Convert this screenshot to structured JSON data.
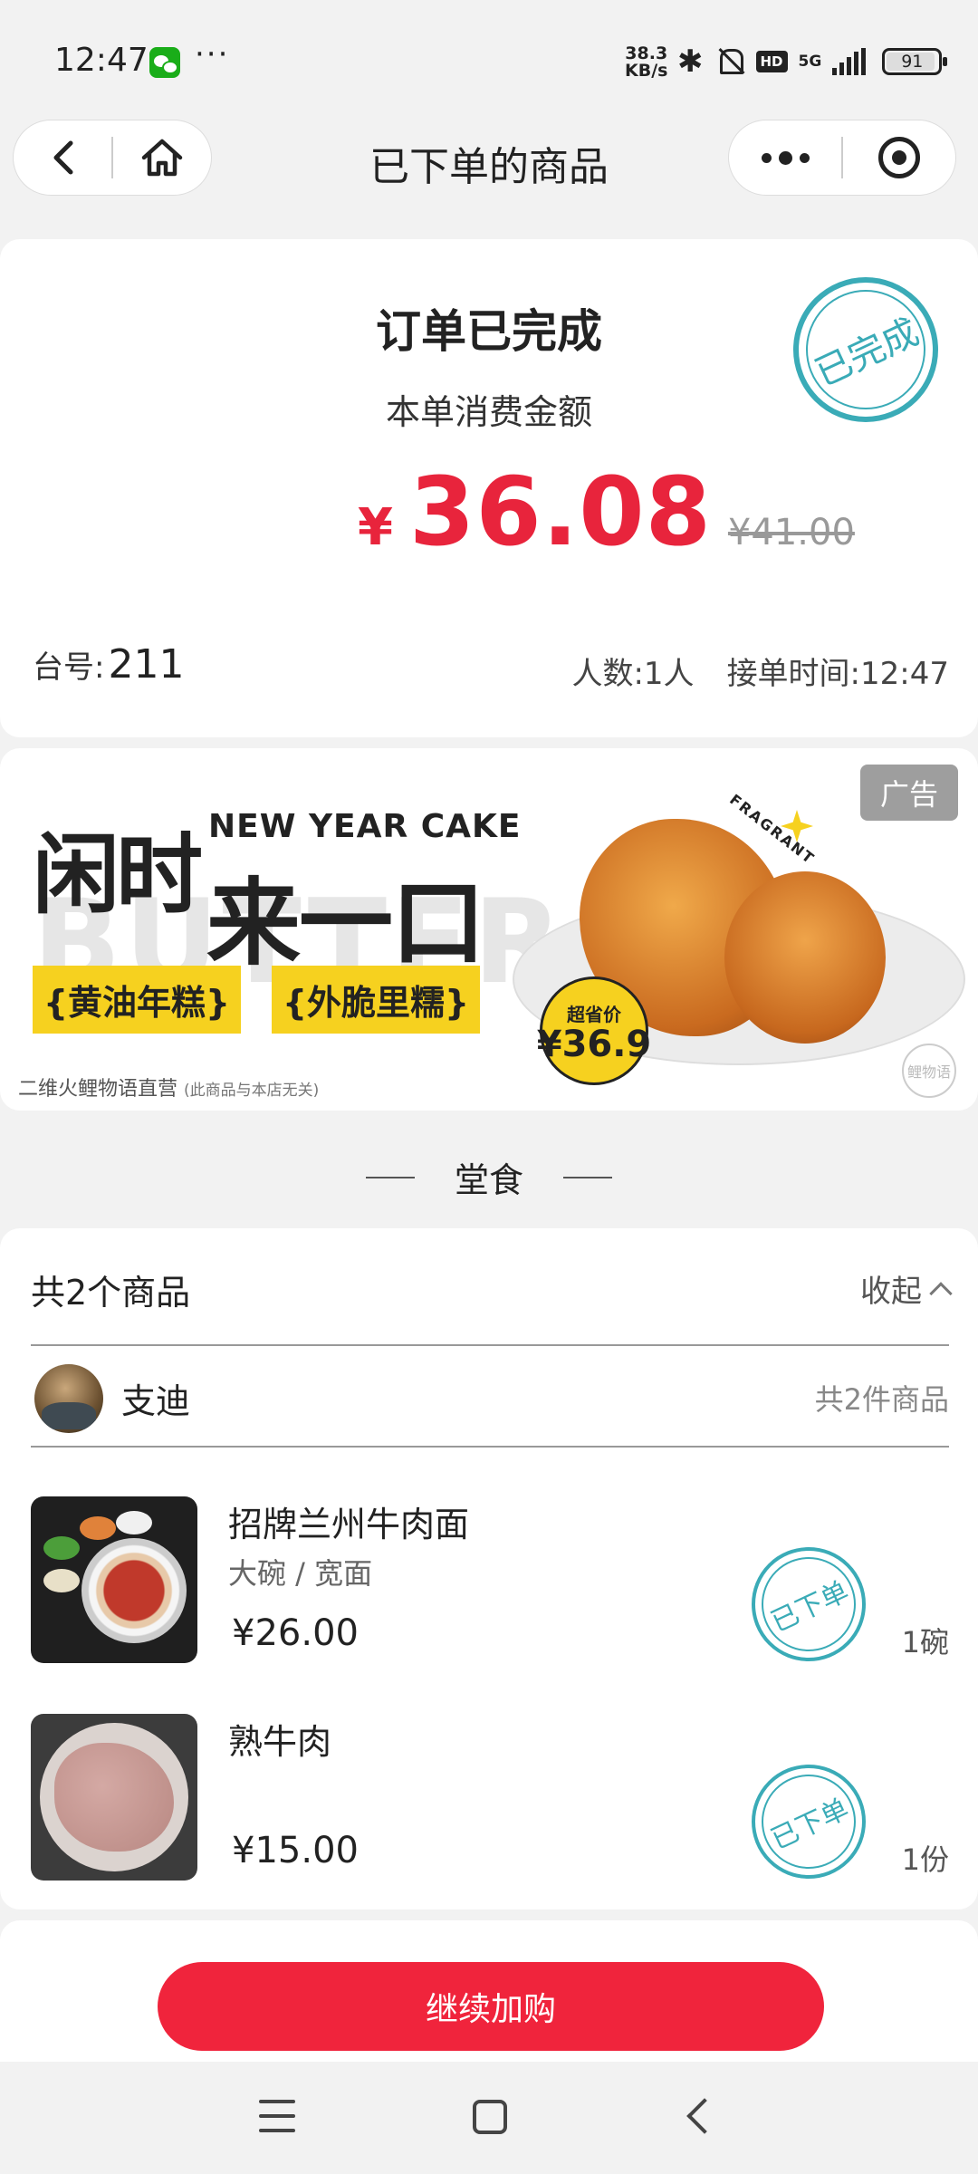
{
  "status_bar": {
    "time": "12:47",
    "more": "···",
    "speed_value": "38.3",
    "speed_unit": "KB/s",
    "hd": "HD",
    "network": "5G",
    "battery": "91",
    "icons": [
      "wechat-icon",
      "bluetooth-icon",
      "mute-bell-icon",
      "hd-icon",
      "signal-icon",
      "battery-icon"
    ]
  },
  "nav": {
    "title": "已下单的商品",
    "icons": [
      "back-arrow-icon",
      "home-icon",
      "more-dots-icon",
      "close-target-icon"
    ]
  },
  "summary": {
    "title": "订单已完成",
    "subtitle": "本单消费金额",
    "currency": "¥",
    "amount": "36.08",
    "original_price": "¥41.00",
    "stamp": "已完成",
    "table_label": "台号:",
    "table_no": "211",
    "people": "人数:1人",
    "order_time": "接单时间:12:47"
  },
  "ad": {
    "label": "广告",
    "headline_1": "闲时",
    "headline_en": "NEW YEAR CAKE",
    "headline_2": "来一口",
    "bg_word": "BUTTER",
    "tag_1": "{黄油年糕}",
    "tag_2": "{外脆里糯}",
    "badge_label": "超省价",
    "badge_price": "¥36.9",
    "fragrant": "FRAGRANT",
    "watermark": "鲤物语",
    "footer": "二维火鲤物语直营",
    "footer_note": "(此商品与本店无关)"
  },
  "section": {
    "title": "堂食"
  },
  "items_card": {
    "count_label": "共2个商品",
    "collapse_label": "收起",
    "user_name": "支迪",
    "user_total": "共2件商品",
    "items": [
      {
        "name": "招牌兰州牛肉面",
        "spec": "大碗 / 宽面",
        "price": "¥26.00",
        "qty": "1碗",
        "stamp": "已下单"
      },
      {
        "name": "熟牛肉",
        "spec": "",
        "price": "¥15.00",
        "qty": "1份",
        "stamp": "已下单"
      }
    ]
  },
  "bottom": {
    "continue_label": "继续加购"
  },
  "colors": {
    "accent_red": "#f0243c",
    "price_red": "#e8243c",
    "stamp_teal": "#3aabb7",
    "ad_yellow": "#f6d11f"
  }
}
